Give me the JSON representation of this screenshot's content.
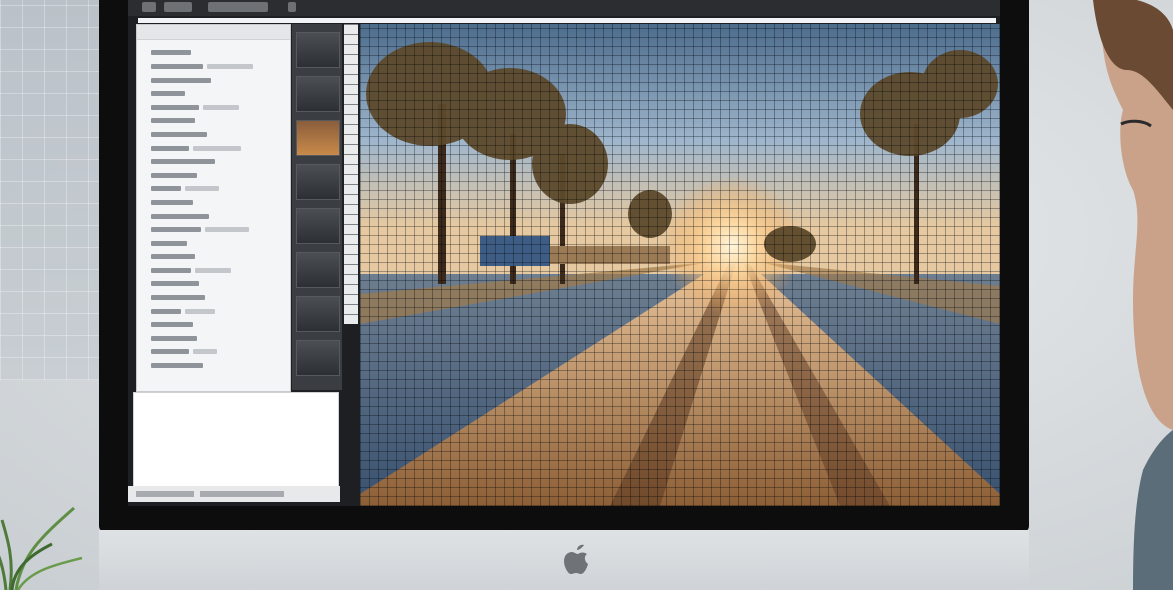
{
  "scene": {
    "description_colors": {
      "wall": "#d6dadd",
      "imac_bezel": "#0d0d0e",
      "imac_chin": "#dfe2e5",
      "sky": "#9fb6cc",
      "sun": "#ffd9a0",
      "road": "#b98a5a"
    }
  },
  "wall_chart": {
    "label_top": "",
    "label_mid": ""
  },
  "editor": {
    "panel_rows": 24,
    "thumbnail_count": 8
  },
  "icons": {
    "apple": "apple-logo-icon",
    "plant": "plant-icon"
  }
}
